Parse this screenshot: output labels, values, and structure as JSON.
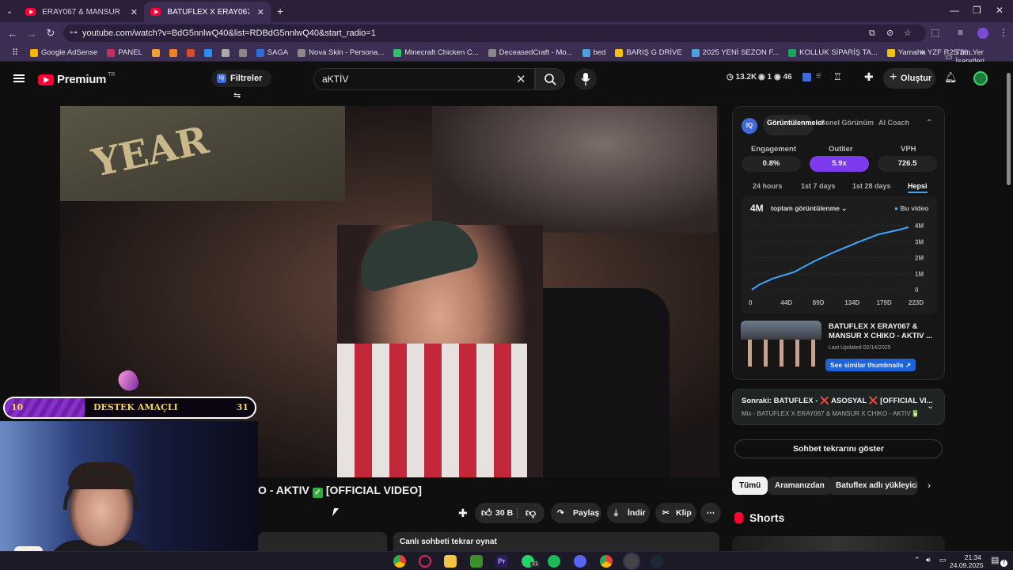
{
  "browser": {
    "tabs": [
      {
        "title": "ERAY067 & MANSUR - BİR KER",
        "close": "✕"
      },
      {
        "title": "BATUFLEX X ERAY067 & M",
        "close": "✕"
      }
    ],
    "new_tab": "+",
    "url": "youtube.com/watch?v=BdG5nnlwQ40&list=RDBdG5nnlwQ40&start_radio=1",
    "bookmarks": [
      {
        "label": "Google AdSense",
        "color": "#f4b400"
      },
      {
        "label": "PANEL",
        "color": "#c03060"
      },
      {
        "label": "",
        "color": "#f0a030"
      },
      {
        "label": "",
        "color": "#f08020"
      },
      {
        "label": "",
        "color": "#d94b2b"
      },
      {
        "label": "",
        "color": "#2a8df0"
      },
      {
        "label": "",
        "color": "#aaa"
      },
      {
        "label": "",
        "color": "#888"
      },
      {
        "label": "SAGA",
        "color": "#2b6fd6"
      },
      {
        "label": "Nova Skin - Persona...",
        "color": "#8a8a8a"
      },
      {
        "label": "Minecraft Chicken C...",
        "color": "#2ec26a"
      },
      {
        "label": "DeceasedCraft - Mo...",
        "color": "#888"
      },
      {
        "label": "bed",
        "color": "#4aa0e0"
      },
      {
        "label": "BARIŞ G DRİVE",
        "color": "#f4c20d"
      },
      {
        "label": "2025 YENİ SEZON F...",
        "color": "#4aa0e0"
      },
      {
        "label": "KOLLUK SİPARİŞ TA...",
        "color": "#1aa260"
      },
      {
        "label": "Yamaha YZF R25 20...",
        "color": "#f4c20d"
      }
    ],
    "bookmarks_more": "»",
    "all_bookmarks": "Tüm Yer İşaretleri"
  },
  "youtube": {
    "logo_text": "Premium",
    "logo_region": "TR",
    "filters_label": "Filtreler",
    "filters_badge": "IQ",
    "search_value": "aKTİV",
    "stats": {
      "views": "13.2K",
      "likes": "1",
      "watchers": "46"
    },
    "create_label": "Oluştur"
  },
  "overlay": {
    "destek_left": "10",
    "destek_label": "DESTEK AMAÇLI",
    "destek_right": "31",
    "destek_progress": 0.32
  },
  "video": {
    "sign_text": "YEAR",
    "title_start": "O - AKTIV",
    "title_end": "[OFFICIAL VIDEO]",
    "check": "✓",
    "likes": "30 B",
    "share": "Paylaş",
    "download": "İndir",
    "clip": "Klip",
    "replay_chat": "Canlı sohbeti tekrar oynat"
  },
  "iq_panel": {
    "badge": "IQ",
    "tabs": [
      "Görüntülenmeler",
      "Genel Görünüm",
      "AI Coach"
    ],
    "metrics": [
      {
        "label": "Engagement",
        "value": "0.8%"
      },
      {
        "label": "Outlier",
        "value": "5.9x"
      },
      {
        "label": "VPH",
        "value": "726.5"
      }
    ],
    "ranges": [
      "24 hours",
      "1st 7 days",
      "1st 28 days",
      "Hepsi"
    ],
    "total": "4M",
    "dropdown": "toplam görüntülenme",
    "legend": "Bu video",
    "related_title": "BATUFLEX X ERAY067 & MANSUR X CHIKO - AKTIV ...",
    "related_updated": "Last Updated 02/14/2025",
    "see_similar": "See similar thumbnails",
    "accent": "#7c3aed"
  },
  "chart_data": {
    "type": "line",
    "x_ticks": [
      "0",
      "44D",
      "89D",
      "134D",
      "179D",
      "223D"
    ],
    "y_ticks": [
      "0",
      "1M",
      "2M",
      "3M",
      "4M"
    ],
    "ylim": [
      0,
      4
    ],
    "series": [
      {
        "name": "Bu video",
        "x": [
          0,
          10,
          30,
          60,
          90,
          120,
          150,
          180,
          210,
          223
        ],
        "y": [
          0,
          0.3,
          0.7,
          1.1,
          1.8,
          2.4,
          2.95,
          3.45,
          3.75,
          3.9
        ]
      }
    ],
    "grid": true,
    "line_color": "#3ea6ff"
  },
  "sidebar": {
    "next_label": "Sonraki:",
    "next_title": "BATUFLEX - ❌ ASOSYAL ❌ [OFFICIAL VI...",
    "next_sub": "Mix - BATUFLEX X ERAY067 & MANSUR X CHIKO - AKTIV ✅ ...",
    "chat_replay": "Sohbet tekrarını göster",
    "chips": [
      "Tümü",
      "Aramanızdan",
      "Batuflex adlı yükleyiciden"
    ],
    "shorts_title": "Shorts"
  },
  "taskbar": {
    "whatsapp_badge": "21",
    "time": "21:34",
    "date": "24.09.2025",
    "notif": "7"
  }
}
